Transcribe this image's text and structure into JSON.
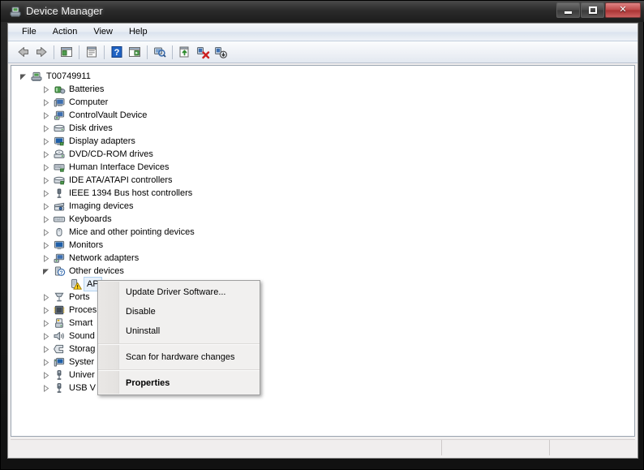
{
  "window": {
    "title": "Device Manager",
    "title_icon": "device-manager-icon",
    "caption": {
      "minimize": "Minimize",
      "maximize": "Maximize",
      "close": "Close",
      "close_glyph": "✕"
    }
  },
  "menubar": {
    "items": [
      {
        "label": "File"
      },
      {
        "label": "Action"
      },
      {
        "label": "View"
      },
      {
        "label": "Help"
      }
    ]
  },
  "toolbar": {
    "buttons": [
      {
        "name": "back-icon",
        "title": "Back"
      },
      {
        "name": "forward-icon",
        "title": "Forward"
      },
      {
        "name": "separator",
        "title": ""
      },
      {
        "name": "show-hide-console-tree-icon",
        "title": "Show/Hide Console Tree"
      },
      {
        "name": "separator",
        "title": ""
      },
      {
        "name": "properties-icon",
        "title": "Properties"
      },
      {
        "name": "separator",
        "title": ""
      },
      {
        "name": "help-icon",
        "title": "Help"
      },
      {
        "name": "show-hide-action-pane-icon",
        "title": "Show/Hide Action Pane"
      },
      {
        "name": "separator",
        "title": ""
      },
      {
        "name": "scan-for-hardware-changes-icon",
        "title": "Scan for hardware changes"
      },
      {
        "name": "separator",
        "title": ""
      },
      {
        "name": "update-driver-software-icon",
        "title": "Update Driver Software"
      },
      {
        "name": "uninstall-device-icon",
        "title": "Uninstall"
      },
      {
        "name": "disable-device-icon",
        "title": "Disable"
      }
    ]
  },
  "tree": {
    "root": {
      "label": "T00749911",
      "icon": "computer-root-icon",
      "expanded": true
    },
    "nodes": [
      {
        "label": "Batteries",
        "icon": "batteries-icon",
        "expandable": true,
        "expanded": false,
        "depth": 1,
        "selected": false
      },
      {
        "label": "Computer",
        "icon": "computer-icon",
        "expandable": true,
        "expanded": false,
        "depth": 1,
        "selected": false
      },
      {
        "label": "ControlVault Device",
        "icon": "controlvault-icon",
        "expandable": true,
        "expanded": false,
        "depth": 1,
        "selected": false
      },
      {
        "label": "Disk drives",
        "icon": "disk-drive-icon",
        "expandable": true,
        "expanded": false,
        "depth": 1,
        "selected": false
      },
      {
        "label": "Display adapters",
        "icon": "display-adapter-icon",
        "expandable": true,
        "expanded": false,
        "depth": 1,
        "selected": false
      },
      {
        "label": "DVD/CD-ROM drives",
        "icon": "dvd-drive-icon",
        "expandable": true,
        "expanded": false,
        "depth": 1,
        "selected": false
      },
      {
        "label": "Human Interface Devices",
        "icon": "hid-icon",
        "expandable": true,
        "expanded": false,
        "depth": 1,
        "selected": false
      },
      {
        "label": "IDE ATA/ATAPI controllers",
        "icon": "ide-controller-icon",
        "expandable": true,
        "expanded": false,
        "depth": 1,
        "selected": false
      },
      {
        "label": "IEEE 1394 Bus host controllers",
        "icon": "ieee1394-icon",
        "expandable": true,
        "expanded": false,
        "depth": 1,
        "selected": false
      },
      {
        "label": "Imaging devices",
        "icon": "imaging-device-icon",
        "expandable": true,
        "expanded": false,
        "depth": 1,
        "selected": false
      },
      {
        "label": "Keyboards",
        "icon": "keyboard-icon",
        "expandable": true,
        "expanded": false,
        "depth": 1,
        "selected": false
      },
      {
        "label": "Mice and other pointing devices",
        "icon": "mouse-icon",
        "expandable": true,
        "expanded": false,
        "depth": 1,
        "selected": false
      },
      {
        "label": "Monitors",
        "icon": "monitor-icon",
        "expandable": true,
        "expanded": false,
        "depth": 1,
        "selected": false
      },
      {
        "label": "Network adapters",
        "icon": "network-adapter-icon",
        "expandable": true,
        "expanded": false,
        "depth": 1,
        "selected": false
      },
      {
        "label": "Other devices",
        "icon": "other-devices-icon",
        "expandable": true,
        "expanded": true,
        "depth": 1,
        "selected": false
      },
      {
        "label": "AP",
        "icon": "unknown-device-warning-icon",
        "expandable": false,
        "expanded": false,
        "depth": 2,
        "selected": true
      },
      {
        "label": "Ports",
        "icon": "ports-icon",
        "expandable": true,
        "expanded": false,
        "depth": 1,
        "selected": false
      },
      {
        "label": "Proces",
        "icon": "processor-icon",
        "expandable": true,
        "expanded": false,
        "depth": 1,
        "selected": false
      },
      {
        "label": "Smart",
        "icon": "smart-card-reader-icon",
        "expandable": true,
        "expanded": false,
        "depth": 1,
        "selected": false
      },
      {
        "label": "Sound",
        "icon": "sound-device-icon",
        "expandable": true,
        "expanded": false,
        "depth": 1,
        "selected": false
      },
      {
        "label": "Storag",
        "icon": "storage-controller-icon",
        "expandable": true,
        "expanded": false,
        "depth": 1,
        "selected": false
      },
      {
        "label": "Syster",
        "icon": "system-device-icon",
        "expandable": true,
        "expanded": false,
        "depth": 1,
        "selected": false
      },
      {
        "label": "Univer",
        "icon": "usb-controller-icon",
        "expandable": true,
        "expanded": false,
        "depth": 1,
        "selected": false
      },
      {
        "label": "USB V",
        "icon": "usb-device-icon",
        "expandable": true,
        "expanded": false,
        "depth": 1,
        "selected": false
      }
    ]
  },
  "context_menu": {
    "items": [
      {
        "label": "Update Driver Software...",
        "type": "item",
        "bold": false
      },
      {
        "label": "Disable",
        "type": "item",
        "bold": false
      },
      {
        "label": "Uninstall",
        "type": "item",
        "bold": false
      },
      {
        "label": "",
        "type": "separator",
        "bold": false
      },
      {
        "label": "Scan for hardware changes",
        "type": "item",
        "bold": false
      },
      {
        "label": "",
        "type": "separator",
        "bold": false
      },
      {
        "label": "Properties",
        "type": "item",
        "bold": true
      }
    ]
  },
  "statusbar": {
    "pane1": "",
    "pane2": "",
    "pane3": ""
  },
  "colors": {
    "titlebar": "#1d1d1d",
    "close_button": "#c04a4a",
    "menubar": "#e7ecf3",
    "content": "#ffffff",
    "selection": "#e8f1fb",
    "warning": "#ffcc00"
  }
}
